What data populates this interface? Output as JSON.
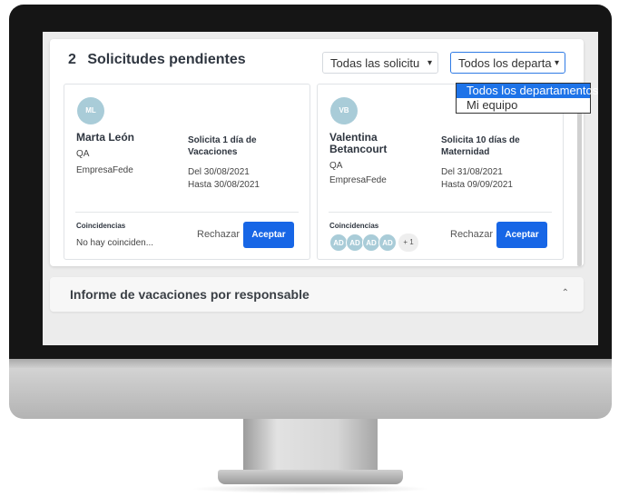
{
  "header": {
    "count": "2",
    "title": "Solicitudes pendientes",
    "filter_requests": {
      "value": "Todas las solicitu"
    },
    "filter_departments": {
      "value": "Todos los departa",
      "options": [
        "Todos los departamentos",
        "Mi equipo"
      ],
      "selected_index": 0
    }
  },
  "cards": [
    {
      "initials": "ML",
      "name": "Marta León",
      "department": "QA",
      "company": "EmpresaFede",
      "request": "Solicita 1 día de Vacaciones",
      "from": "Del 30/08/2021",
      "to": "Hasta 30/08/2021",
      "coincidences_label": "Coincidencias",
      "coincidences_text": "No hay coinciden...",
      "reject_label": "Rechazar",
      "accept_label": "Aceptar"
    },
    {
      "initials": "VB",
      "name": "Valentina Betancourt",
      "department": "QA",
      "company": "EmpresaFede",
      "request": "Solicita 10 días de Maternidad",
      "from": "Del 31/08/2021",
      "to": "Hasta 09/09/2021",
      "coincidences_label": "Coincidencias",
      "coincidence_chips": [
        "AD",
        "AD",
        "AD",
        "AD"
      ],
      "coincidence_more": "+ 1",
      "reject_label": "Rechazar",
      "accept_label": "Aceptar"
    }
  ],
  "report": {
    "title": "Informe de vacaciones por responsable",
    "caret_icon": "chevron-up-icon"
  },
  "colors": {
    "accent": "#1766e6",
    "dropdown_highlight": "#1e73e8",
    "avatar": "#a9ccd8",
    "page_bg": "#ececec"
  }
}
